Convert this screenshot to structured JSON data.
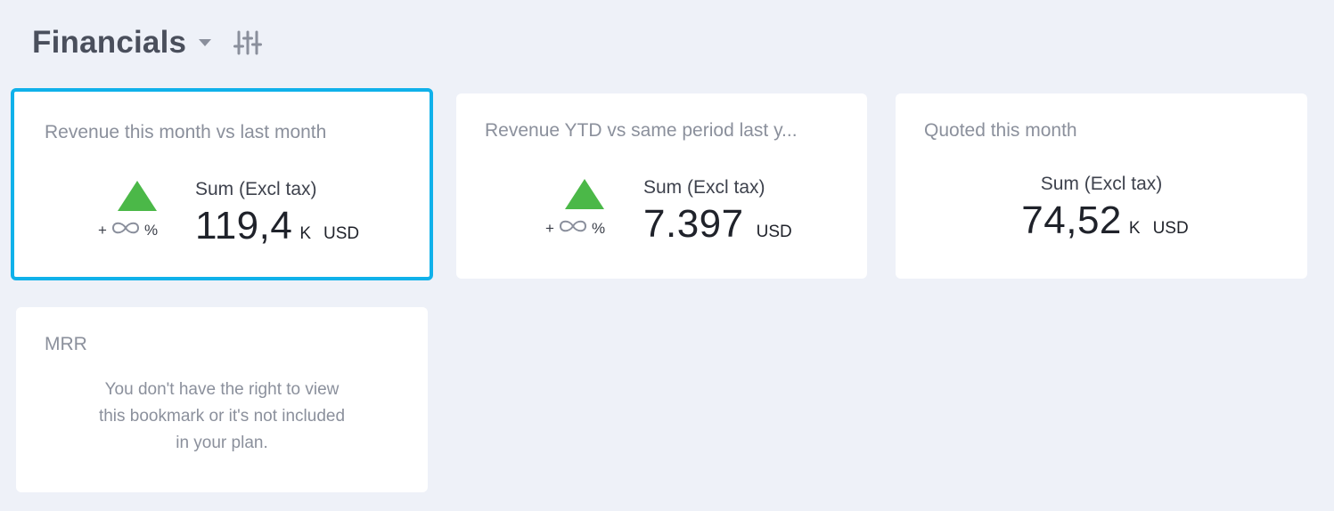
{
  "header": {
    "title": "Financials",
    "dropdown_icon": "caret-down-icon",
    "filters_icon": "sliders-icon"
  },
  "colors": {
    "background": "#eef1f8",
    "card": "#ffffff",
    "selected_border": "#10b1ea",
    "trend_up": "#4bb848"
  },
  "cards": [
    {
      "title": "Revenue this month vs last month",
      "trend": {
        "direction": "up",
        "prefix": "+",
        "value": "∞",
        "suffix": "%"
      },
      "label": "Sum (Excl tax)",
      "value": "119,4",
      "magnitude": "K",
      "unit": "USD",
      "selected": true
    },
    {
      "title": "Revenue YTD vs same period last y...",
      "trend": {
        "direction": "up",
        "prefix": "+",
        "value": "∞",
        "suffix": "%"
      },
      "label": "Sum (Excl tax)",
      "value": "7.397",
      "magnitude": "",
      "unit": "USD",
      "selected": false
    },
    {
      "title": "Quoted this month",
      "label": "Sum (Excl tax)",
      "value": "74,52",
      "magnitude": "K",
      "unit": "USD",
      "selected": false
    },
    {
      "title": "MRR",
      "message_lines": [
        "You don't have the right to view",
        "this bookmark or it's not included",
        "in your plan."
      ]
    }
  ]
}
